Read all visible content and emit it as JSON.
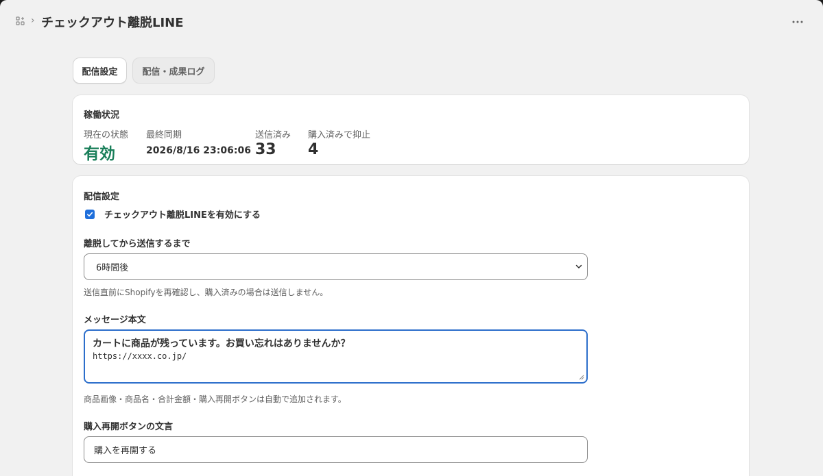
{
  "header": {
    "app_icon": "app-grid-icon",
    "separator": "›",
    "title": "チェックアウト離脱LINE",
    "more_icon": "more-horizontal-icon"
  },
  "tabs": [
    {
      "label": "配信設定",
      "active": true
    },
    {
      "label": "配信・成果ログ",
      "active": false
    }
  ],
  "status_card": {
    "title": "稼働状況",
    "stats": {
      "status": {
        "label": "現在の状態",
        "value": "有効",
        "color": "#1a7f5a"
      },
      "last_sync": {
        "label": "最終同期",
        "value": "2026/8/16 23:06:06"
      },
      "sent": {
        "label": "送信済み",
        "value": "33"
      },
      "suppressed": {
        "label": "購入済みで抑止",
        "value": "4"
      }
    }
  },
  "settings_card": {
    "title": "配信設定",
    "enable_checkbox": {
      "label": "チェックアウト離脱LINEを有効にする",
      "checked": true
    },
    "delay": {
      "label": "離脱してから送信するまで",
      "selected": "6時間後",
      "help": "送信直前にShopifyを再確認し、購入済みの場合は送信しません。"
    },
    "message": {
      "label": "メッセージ本文",
      "line1": "カートに商品が残っています。お買い忘れはありませんか？",
      "line2": "https://xxxx.co.jp/",
      "help": "商品画像・商品名・合計金額・購入再開ボタンは自動で追加されます。"
    },
    "button_text": {
      "label": "購入再開ボタンの文言",
      "value": "購入を再開する"
    }
  },
  "colors": {
    "accent": "#2c6ecb",
    "checkbox": "#1f6fdb",
    "status_active": "#1a7f5a",
    "background": "#f1f1f1"
  }
}
